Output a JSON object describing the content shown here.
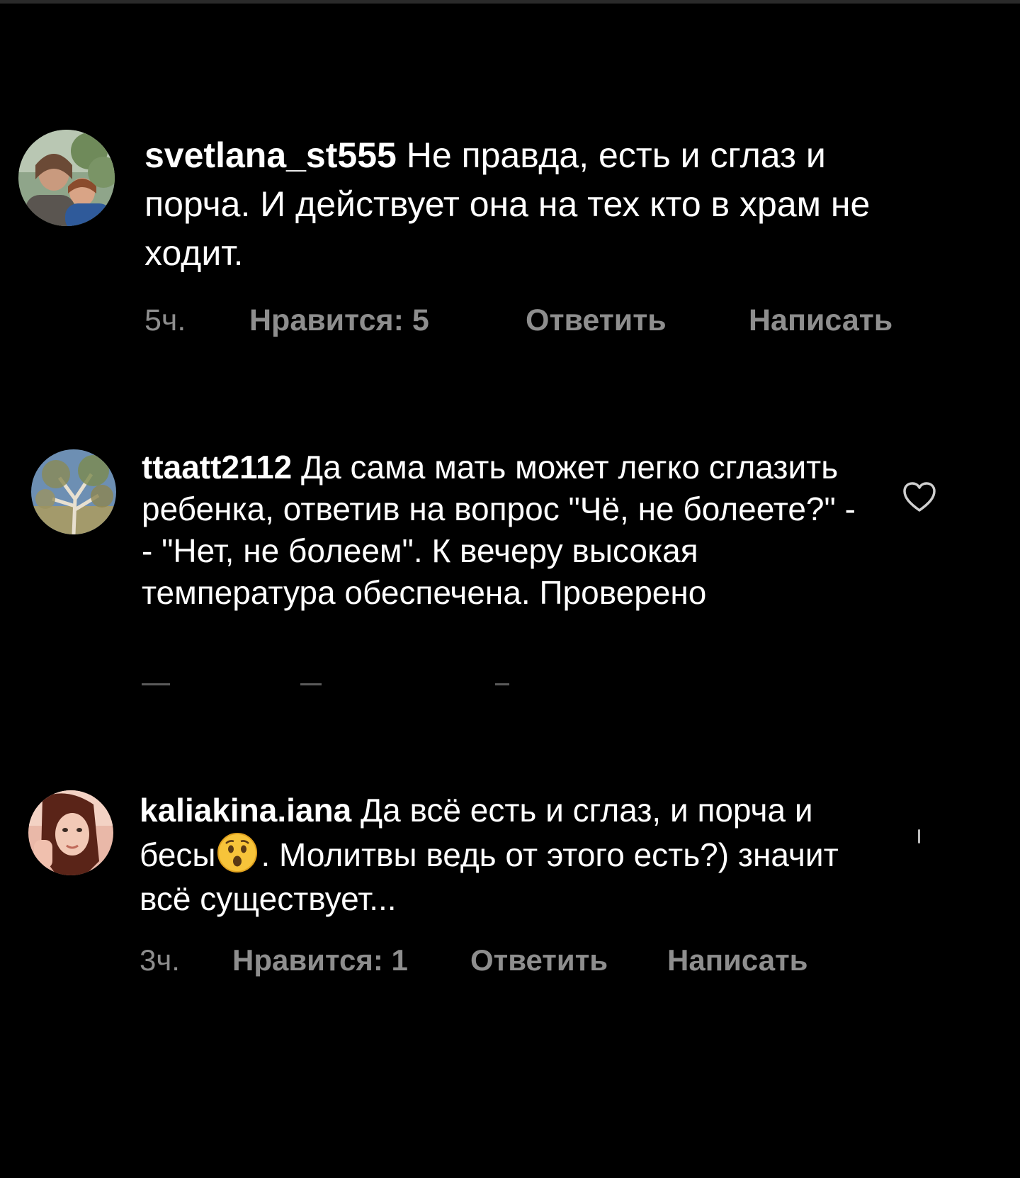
{
  "comments": [
    {
      "username": "svetlana_st555",
      "text": "Не правда, есть и сглаз и порча. И действует она на тех кто в храм не ходит.",
      "time": "5ч.",
      "likes": "Нравится: 5",
      "reply": "Ответить",
      "message": "Написать"
    },
    {
      "username": "ttaatt2112",
      "text": "Да сама мать может легко сглазить ребенка, ответив на вопрос \"Чё, не болеете?\" -- \"Нет, не болеем\". К вечеру высокая температура обеспечена. Проверено",
      "like_icon": "heart-outline-icon"
    },
    {
      "username": "kaliakina.iana",
      "text_before": "Да всё есть и сглаз, и порча и бесы",
      "emoji": "astonished-face-emoji",
      "text_after": ". Молитвы ведь от этого есть?) значит всё существует...",
      "time": "3ч.",
      "likes": "Нравится: 1",
      "reply": "Ответить",
      "message": "Написать"
    }
  ],
  "colors": {
    "background": "#000000",
    "text": "#ffffff",
    "secondary_text": "#8e8e8e"
  }
}
